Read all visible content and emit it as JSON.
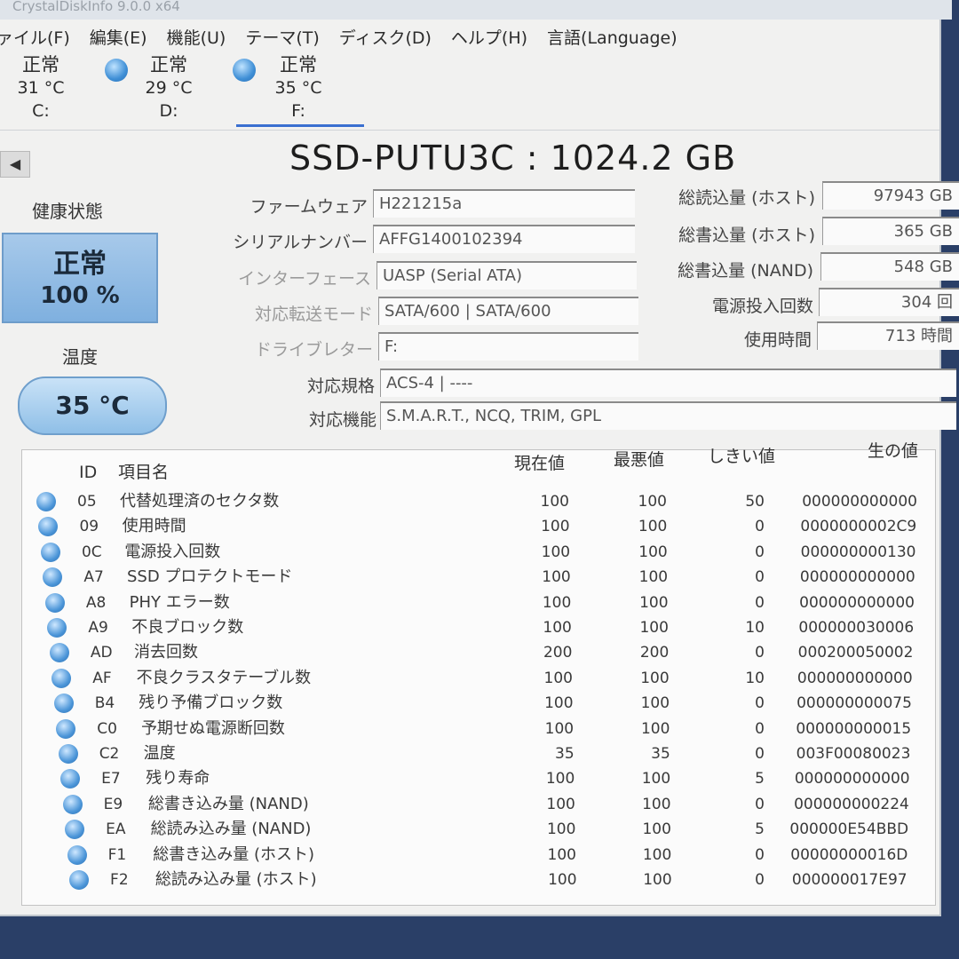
{
  "window": {
    "title": "CrystalDiskInfo 9.0.0 x64"
  },
  "menu": [
    "ァイル(F)",
    "編集(E)",
    "機能(U)",
    "テーマ(T)",
    "ディスク(D)",
    "ヘルプ(H)",
    "言語(Language)"
  ],
  "drives": [
    {
      "status": "正常",
      "temp": "31 °C",
      "letter": "C:"
    },
    {
      "status": "正常",
      "temp": "29 °C",
      "letter": "D:"
    },
    {
      "status": "正常",
      "temp": "35 °C",
      "letter": "F:"
    }
  ],
  "nav": {
    "prev": "◀"
  },
  "model": {
    "title": "SSD-PUTU3C : 1024.2 GB"
  },
  "health": {
    "label": "健康状態",
    "status": "正常",
    "percent": "100 %"
  },
  "temperature": {
    "label": "温度",
    "value": "35 °C"
  },
  "info": [
    {
      "label": "ファームウェア",
      "value": "H221215a"
    },
    {
      "label": "シリアルナンバー",
      "value": "AFFG1400102394"
    },
    {
      "label": "インターフェース",
      "value": "UASP (Serial ATA)"
    },
    {
      "label": "対応転送モード",
      "value": "SATA/600 | SATA/600"
    },
    {
      "label": "ドライブレター",
      "value": "F:"
    },
    {
      "label": "対応規格",
      "value": "ACS-4 | ----"
    },
    {
      "label": "対応機能",
      "value": "S.M.A.R.T., NCQ, TRIM, GPL"
    }
  ],
  "stats": [
    {
      "label": "総読込量 (ホスト)",
      "value": "97943 GB"
    },
    {
      "label": "総書込量 (ホスト)",
      "value": "365 GB"
    },
    {
      "label": "総書込量 (NAND)",
      "value": "548 GB"
    },
    {
      "label": "電源投入回数",
      "value": "304 回"
    },
    {
      "label": "使用時間",
      "value": "713 時間"
    }
  ],
  "smart": {
    "headers": {
      "id": "ID",
      "name": "項目名",
      "current": "現在値",
      "worst": "最悪値",
      "threshold": "しきい値",
      "raw": "生の値"
    },
    "rows": [
      {
        "id": "05",
        "name": "代替処理済のセクタ数",
        "current": "100",
        "worst": "100",
        "threshold": "50",
        "raw": "000000000000"
      },
      {
        "id": "09",
        "name": "使用時間",
        "current": "100",
        "worst": "100",
        "threshold": "0",
        "raw": "0000000002C9"
      },
      {
        "id": "0C",
        "name": "電源投入回数",
        "current": "100",
        "worst": "100",
        "threshold": "0",
        "raw": "000000000130"
      },
      {
        "id": "A7",
        "name": "SSD プロテクトモード",
        "current": "100",
        "worst": "100",
        "threshold": "0",
        "raw": "000000000000"
      },
      {
        "id": "A8",
        "name": "PHY エラー数",
        "current": "100",
        "worst": "100",
        "threshold": "0",
        "raw": "000000000000"
      },
      {
        "id": "A9",
        "name": "不良ブロック数",
        "current": "100",
        "worst": "100",
        "threshold": "10",
        "raw": "000000030006"
      },
      {
        "id": "AD",
        "name": "消去回数",
        "current": "200",
        "worst": "200",
        "threshold": "0",
        "raw": "000200050002"
      },
      {
        "id": "AF",
        "name": "不良クラスタテーブル数",
        "current": "100",
        "worst": "100",
        "threshold": "10",
        "raw": "000000000000"
      },
      {
        "id": "B4",
        "name": "残り予備ブロック数",
        "current": "100",
        "worst": "100",
        "threshold": "0",
        "raw": "000000000075"
      },
      {
        "id": "C0",
        "name": "予期せぬ電源断回数",
        "current": "100",
        "worst": "100",
        "threshold": "0",
        "raw": "000000000015"
      },
      {
        "id": "C2",
        "name": "温度",
        "current": "35",
        "worst": "35",
        "threshold": "0",
        "raw": "003F00080023"
      },
      {
        "id": "E7",
        "name": "残り寿命",
        "current": "100",
        "worst": "100",
        "threshold": "5",
        "raw": "000000000000"
      },
      {
        "id": "E9",
        "name": "総書き込み量 (NAND)",
        "current": "100",
        "worst": "100",
        "threshold": "0",
        "raw": "000000000224"
      },
      {
        "id": "EA",
        "name": "総読み込み量 (NAND)",
        "current": "100",
        "worst": "100",
        "threshold": "5",
        "raw": "000000E54BBD"
      },
      {
        "id": "F1",
        "name": "総書き込み量 (ホスト)",
        "current": "100",
        "worst": "100",
        "threshold": "0",
        "raw": "00000000016D"
      },
      {
        "id": "F2",
        "name": "総読み込み量 (ホスト)",
        "current": "100",
        "worst": "100",
        "threshold": "0",
        "raw": "000000017E97"
      }
    ]
  }
}
